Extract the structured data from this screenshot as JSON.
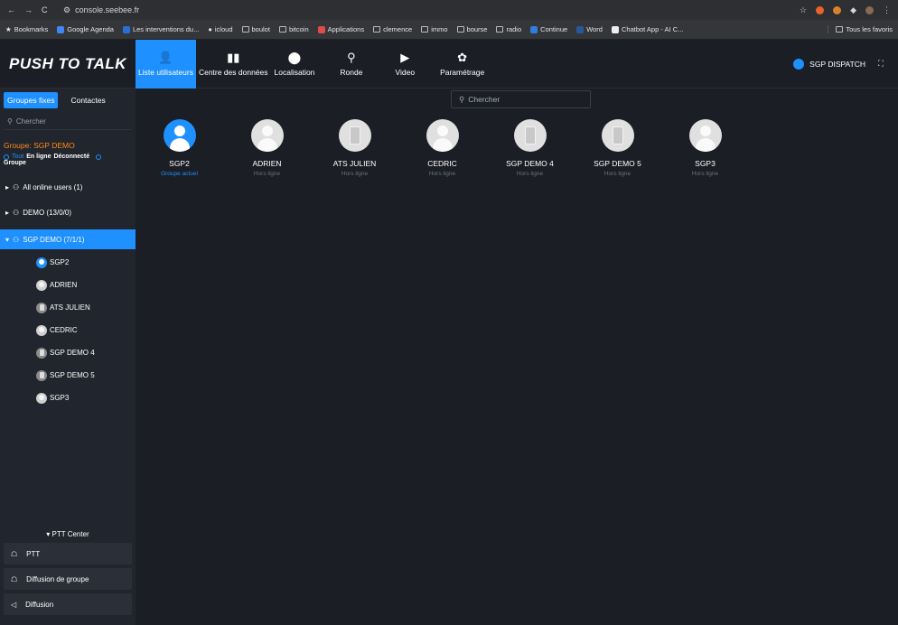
{
  "browser": {
    "url": "console.seebee.fr",
    "bookmarks": [
      "Bookmarks",
      "Google Agenda",
      "Les interventions du...",
      "icloud",
      "boulot",
      "bitcoin",
      "Applications",
      "clemence",
      "immo",
      "bourse",
      "radio",
      "Continue",
      "Word",
      "Chatbot App - AI C..."
    ],
    "bookmarks_right": "Tous les favoris"
  },
  "header": {
    "logo": "PUSH TO TALK",
    "tabs": [
      {
        "label": "Liste utilisateurs",
        "icon": "user-list-icon"
      },
      {
        "label": "Centre des données",
        "icon": "bar-chart-icon"
      },
      {
        "label": "Localisation",
        "icon": "location-pin-icon"
      },
      {
        "label": "Ronde",
        "icon": "patrol-icon"
      },
      {
        "label": "Video",
        "icon": "play-circle-icon"
      },
      {
        "label": "Paramétrage",
        "icon": "gear-icon"
      }
    ],
    "user": "SGP DISPATCH"
  },
  "sidebar": {
    "tabs": [
      "Groupes fixes",
      "Contactes"
    ],
    "search_placeholder": "Chercher",
    "group_label": "Groupe: SGP DEMO",
    "filters": {
      "all": "Tout",
      "online": "En ligne",
      "offline": "Déconnecté",
      "group": "Groupe"
    },
    "tree": [
      "All online users (1)",
      "DEMO (13/0/0)",
      "SGP DEMO (7/1/1)"
    ],
    "members": [
      "SGP2",
      "ADRIEN",
      "ATS JULIEN",
      "CEDRIC",
      "SGP DEMO 4",
      "SGP DEMO 5",
      "SGP3"
    ],
    "ptt_center": "PTT Center",
    "ptt_items": [
      "PTT",
      "Diffusion de groupe",
      "Diffusion"
    ]
  },
  "main": {
    "search_placeholder": "Chercher",
    "users": [
      {
        "name": "SGP2",
        "status": "Groupe actuel",
        "type": "person",
        "current": true
      },
      {
        "name": "ADRIEN",
        "status": "Hors ligne",
        "type": "person",
        "current": false
      },
      {
        "name": "ATS JULIEN",
        "status": "Hors ligne",
        "type": "radio",
        "current": false
      },
      {
        "name": "CEDRIC",
        "status": "Hors ligne",
        "type": "person",
        "current": false
      },
      {
        "name": "SGP DEMO 4",
        "status": "Hors ligne",
        "type": "phone",
        "current": false
      },
      {
        "name": "SGP DEMO 5",
        "status": "Hors ligne",
        "type": "phone",
        "current": false
      },
      {
        "name": "SGP3",
        "status": "Hors ligne",
        "type": "person",
        "current": false
      }
    ]
  },
  "colors": {
    "accent": "#1e90ff",
    "group_orange": "#ff8c1a",
    "background": "#1b1e25",
    "sidebar": "#21252d"
  }
}
